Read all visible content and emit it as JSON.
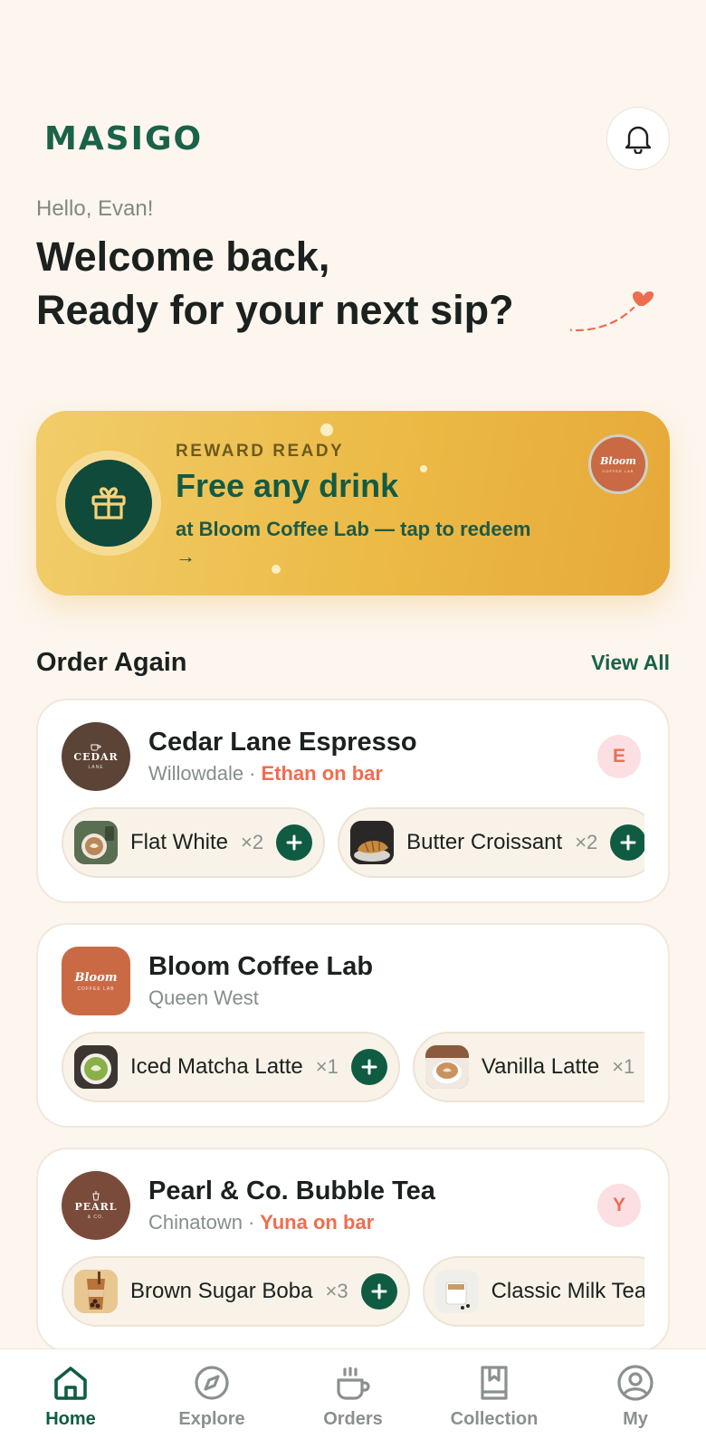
{
  "app": {
    "logo": "MASIGO"
  },
  "greeting": {
    "hello": "Hello, Evan!",
    "line1": "Welcome back,",
    "line2": "Ready for your next sip?"
  },
  "reward": {
    "kicker": "REWARD READY",
    "title": "Free any drink",
    "subtitle": "at Bloom Coffee Lab — tap to redeem",
    "arrow": "→",
    "badge_word": "Bloom",
    "badge_sub": "COFFEE LAB"
  },
  "order_again": {
    "title": "Order Again",
    "view_all": "View All"
  },
  "shops": [
    {
      "name": "Cedar Lane Espresso",
      "area": "Willowdale",
      "separator": "·",
      "barista_text": "Ethan on bar",
      "barista_initial": "E",
      "logo_word": "CEDAR",
      "logo_sub": "LANE",
      "logo_color": "#5b4335",
      "items": [
        {
          "name": "Flat White",
          "qty": "×2",
          "icon": "latte-photo"
        },
        {
          "name": "Butter Croissant",
          "qty": "×2",
          "icon": "croissant-photo"
        }
      ]
    },
    {
      "name": "Bloom Coffee Lab",
      "area": "Queen West",
      "logo_word": "Bloom",
      "logo_sub": "COFFEE LAB",
      "logo_color": "#c96a45",
      "items": [
        {
          "name": "Iced Matcha Latte",
          "qty": "×1",
          "icon": "matcha-photo"
        },
        {
          "name": "Vanilla Latte",
          "qty": "×1",
          "icon": "cappuccino-photo"
        }
      ]
    },
    {
      "name": "Pearl & Co. Bubble Tea",
      "area": "Chinatown",
      "separator": "·",
      "barista_text": "Yuna on bar",
      "barista_initial": "Y",
      "logo_word": "PEARL",
      "logo_sub": "& CO.",
      "logo_color": "#7a4a3a",
      "items": [
        {
          "name": "Brown Sugar Boba",
          "qty": "×3",
          "icon": "boba-photo"
        },
        {
          "name": "Classic Milk Tea",
          "qty": "",
          "icon": "milk-tea-photo"
        }
      ]
    }
  ],
  "tabs": [
    {
      "label": "Home",
      "icon": "home-icon",
      "active": true
    },
    {
      "label": "Explore",
      "icon": "compass-icon",
      "active": false
    },
    {
      "label": "Orders",
      "icon": "coffee-cup-icon",
      "active": false
    },
    {
      "label": "Collection",
      "icon": "bookmark-book-icon",
      "active": false
    },
    {
      "label": "My",
      "icon": "user-circle-icon",
      "active": false
    }
  ],
  "colors": {
    "brand_green": "#0f5c43",
    "background": "#fdf6ee",
    "reward_gold": "#ecba46",
    "accent_coral": "#ef6d4f"
  }
}
